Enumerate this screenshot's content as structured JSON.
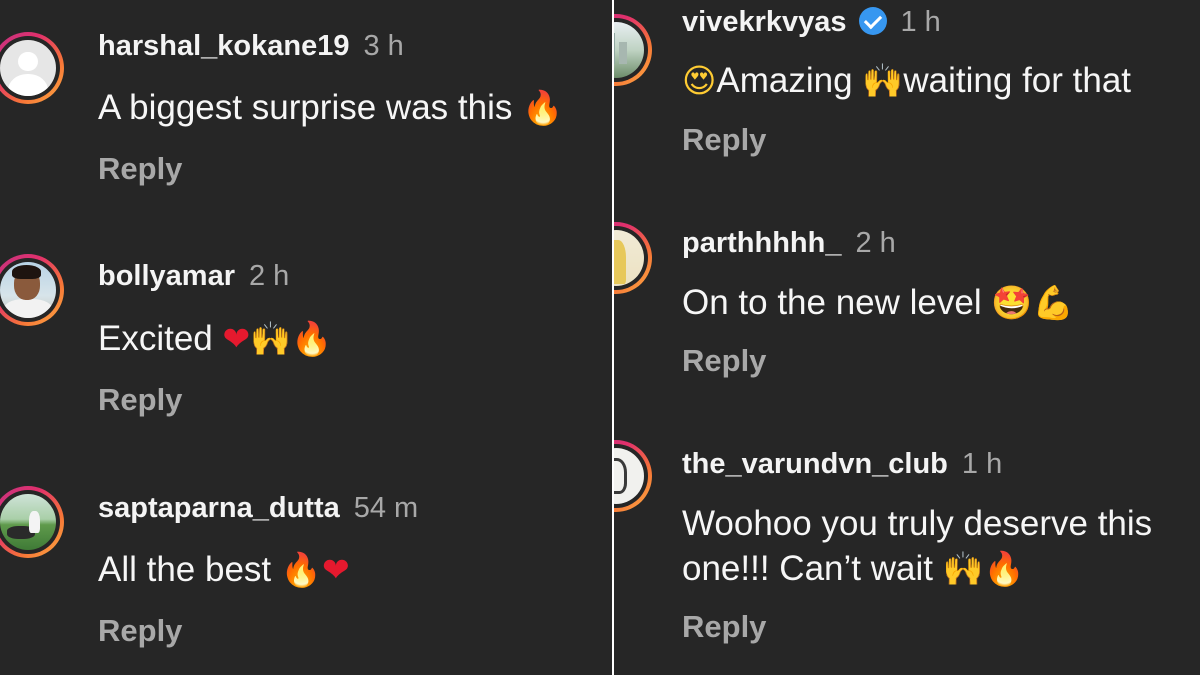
{
  "left_panel": {
    "comments": [
      {
        "username": "harshal_kokane19",
        "time": "3 h",
        "text": "A biggest surprise was this",
        "emojis": [
          "fire-emoji"
        ],
        "reply": "Reply"
      },
      {
        "username": "bollyamar",
        "time": "2 h",
        "text": "Excited",
        "emojis": [
          "heart-emoji",
          "raised-hands-emoji",
          "fire-emoji"
        ],
        "reply": "Reply"
      },
      {
        "username": "saptaparna_dutta",
        "time": "54 m",
        "text": "All the best",
        "emojis": [
          "fire-emoji",
          "heart-emoji"
        ],
        "reply": "Reply"
      }
    ]
  },
  "right_panel": {
    "comments": [
      {
        "username": "vivekrkvyas",
        "verified": true,
        "time": "1 h",
        "text_pre": "",
        "text": "Amazing",
        "text_mid": "waiting for that",
        "emojis": [
          "heart-eyes-emoji",
          "raised-hands-emoji"
        ],
        "reply": "Reply"
      },
      {
        "username": "parthhhhh_",
        "time": "2 h",
        "text": "On to the new level",
        "emojis": [
          "star-struck-emoji",
          "flexed-biceps-emoji"
        ],
        "reply": "Reply"
      },
      {
        "username": "the_varundvn_club",
        "time": "1 h",
        "text_line1": "Woohoo you truly deserve this",
        "text_line2": "one!!! Can’t wait",
        "emojis": [
          "raised-hands-emoji",
          "fire-emoji"
        ],
        "reply": "Reply"
      }
    ]
  }
}
